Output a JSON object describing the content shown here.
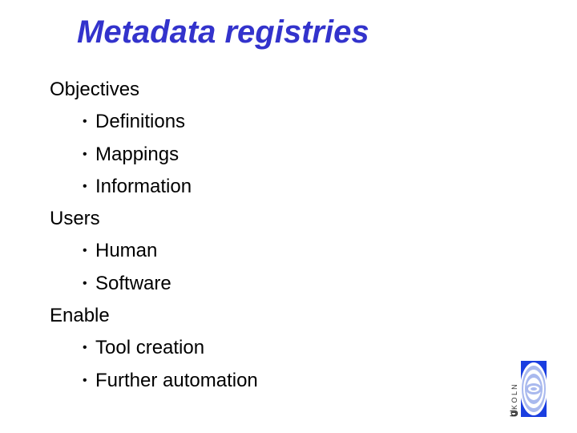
{
  "slide": {
    "title": "Metadata registries",
    "sections": [
      {
        "heading": "Objectives",
        "items": [
          "Definitions",
          "Mappings",
          "Information"
        ]
      },
      {
        "heading": "Users",
        "items": [
          "Human",
          "Software"
        ]
      },
      {
        "heading": "Enable",
        "items": [
          "Tool creation",
          "Further automation"
        ]
      }
    ],
    "bullet_glyph": "•"
  },
  "logo": {
    "text": "UKOLN",
    "icon": "ukoln-eye-logo",
    "colors": {
      "primary": "#1a3ee0",
      "rings": "#a9b9ee",
      "background": "#ffffff"
    }
  },
  "colors": {
    "title": "#3333cc",
    "body": "#000000"
  }
}
